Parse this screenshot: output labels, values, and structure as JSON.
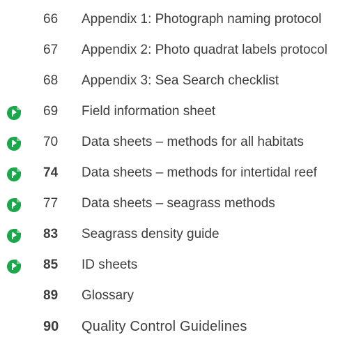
{
  "toc": {
    "entries": [
      {
        "page": "66",
        "title": "Appendix 1: Photograph naming protocol",
        "marker": false,
        "bold_page": false
      },
      {
        "page": "67",
        "title": "Appendix 2: Photo quadrat labels protocol",
        "marker": false,
        "bold_page": false
      },
      {
        "page": "68",
        "title": "Appendix 3: Sea Search checklist",
        "marker": false,
        "bold_page": false
      },
      {
        "page": "69",
        "title": "Field information sheet",
        "marker": true,
        "bold_page": false
      },
      {
        "page": "70",
        "title": "Data sheets – methods for all habitats",
        "marker": true,
        "bold_page": false
      },
      {
        "page": "74",
        "title": "Data sheets – methods for intertidal reef",
        "marker": true,
        "bold_page": true
      },
      {
        "page": "77",
        "title": "Data sheets – seagrass methods",
        "marker": true,
        "bold_page": false
      },
      {
        "page": "83",
        "title": "Seagrass density guide",
        "marker": true,
        "bold_page": true
      },
      {
        "page": "85",
        "title": "ID sheets",
        "marker": true,
        "bold_page": true
      },
      {
        "page": "89",
        "title": "Glossary",
        "marker": false,
        "bold_page": true
      },
      {
        "page": "90",
        "title": "Quality Control Guidelines",
        "marker": false,
        "bold_page": true
      }
    ]
  },
  "colors": {
    "marker_fill": "#19a84a",
    "text": "#3d3d3d"
  },
  "icons": {
    "marker": "printable-sheet-icon"
  }
}
